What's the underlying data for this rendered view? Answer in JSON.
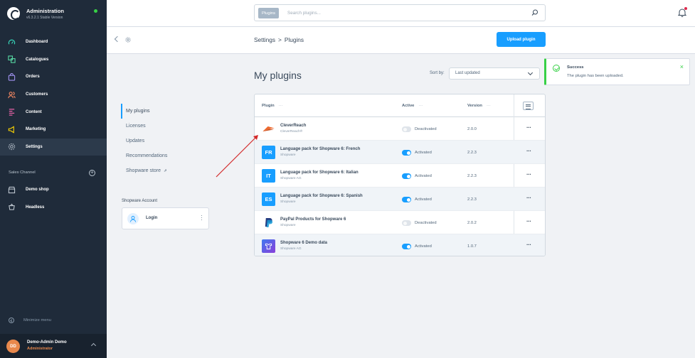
{
  "app": {
    "title": "Administration",
    "version": "v6.3.2.1 Stable Version"
  },
  "sidebar": {
    "items": [
      {
        "label": "Dashboard",
        "icon": "gauge-icon"
      },
      {
        "label": "Catalogues",
        "icon": "catalogue-icon"
      },
      {
        "label": "Orders",
        "icon": "shopping-bag-icon"
      },
      {
        "label": "Customers",
        "icon": "users-icon"
      },
      {
        "label": "Content",
        "icon": "content-icon"
      },
      {
        "label": "Marketing",
        "icon": "megaphone-icon"
      },
      {
        "label": "Settings",
        "icon": "gear-icon"
      }
    ],
    "sales_channel_label": "Sales Channel",
    "channels": [
      {
        "label": "Demo shop",
        "icon": "storefront-icon"
      },
      {
        "label": "Headless",
        "icon": "headless-icon"
      }
    ],
    "minimize_label": "Minimize menu",
    "user": {
      "initials": "DD",
      "name": "Demo-Admin Demo",
      "role": "Administrator"
    }
  },
  "search": {
    "type_label": "Plugins",
    "placeholder": "Search plugins..."
  },
  "header": {
    "breadcrumb": [
      "Settings",
      ">",
      "Plugins"
    ],
    "upload_label": "Upload plugin"
  },
  "content_menu": {
    "items": [
      "My plugins",
      "Licenses",
      "Updates",
      "Recommendations",
      "Shopware store"
    ],
    "account_title": "Shopware Account",
    "login_label": "Login"
  },
  "main": {
    "title": "My plugins",
    "sort_label": "Sort by:",
    "sort_value": "Last updated"
  },
  "grid": {
    "columns": {
      "plugin": "Plugin",
      "active": "Active",
      "version": "Version",
      "dots": "···"
    },
    "rows": [
      {
        "name": "CleverReach",
        "maker": "CleverReach®",
        "active": false,
        "status": "Deactivated",
        "version": "2.0.0",
        "icon": "cleverreach-logo",
        "icon_text": "",
        "color": "#ffffff"
      },
      {
        "name": "Language pack for Shopware 6: French",
        "maker": "Shopware",
        "active": true,
        "status": "Activated",
        "version": "2.2.3",
        "icon": "language-pack-icon",
        "icon_text": "FR",
        "color": "#189eff"
      },
      {
        "name": "Language pack for Shopware 6: Italian",
        "maker": "Shopware AG",
        "active": true,
        "status": "Activated",
        "version": "2.2.3",
        "icon": "language-pack-icon",
        "icon_text": "IT",
        "color": "#189eff"
      },
      {
        "name": "Language pack for Shopware 6: Spanish",
        "maker": "Shopware",
        "active": true,
        "status": "Activated",
        "version": "2.2.3",
        "icon": "language-pack-icon",
        "icon_text": "ES",
        "color": "#189eff"
      },
      {
        "name": "PayPal Products for Shopware 6",
        "maker": "Shopware",
        "active": false,
        "status": "Deactivated",
        "version": "2.0.2",
        "icon": "paypal-icon",
        "icon_text": "",
        "color": "#ffffff"
      },
      {
        "name": "Shopware 6 Demo data",
        "maker": "Shopware AG",
        "active": true,
        "status": "Activated",
        "version": "1.0.7",
        "icon": "demo-data-icon",
        "icon_text": "",
        "color": "#5a3fd9"
      }
    ],
    "row_actions": "···"
  },
  "notification": {
    "title": "Success",
    "message": "The plugin has been uploaded."
  },
  "colors": {
    "accent": "#189eff",
    "success": "#37d046",
    "sidebar": "#1f2b3a"
  }
}
